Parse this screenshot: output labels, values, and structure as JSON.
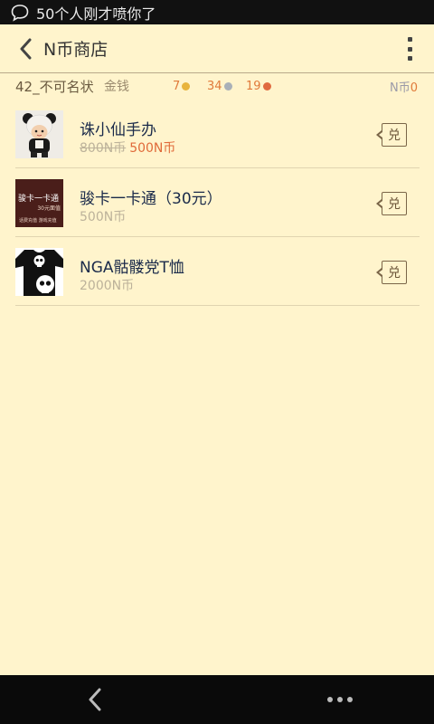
{
  "status": {
    "notification": "50个人刚才喷你了"
  },
  "header": {
    "title": "N币商店"
  },
  "info": {
    "username": "42_不可名状",
    "money_label": "金钱",
    "gold": "7",
    "silver": "34",
    "copper": "19",
    "ncoin_label": "N币",
    "ncoin_value": "0"
  },
  "items": [
    {
      "name": "诛小仙手办",
      "old_price": "800N币",
      "price": "500N币",
      "redeem_label": "兑"
    },
    {
      "name": "骏卡一卡通（30元）",
      "price": "500N币",
      "redeem_label": "兑",
      "thumb": {
        "title": "骏卡一卡通",
        "sub": "30元面值",
        "caption": "话费充值 游戏充值"
      }
    },
    {
      "name": "NGA骷髅党T恤",
      "price": "2000N币",
      "redeem_label": "兑"
    }
  ],
  "colors": {
    "background": "#fff4cc",
    "accent": "#e06a3a",
    "navbar": "#0a0a0a"
  }
}
